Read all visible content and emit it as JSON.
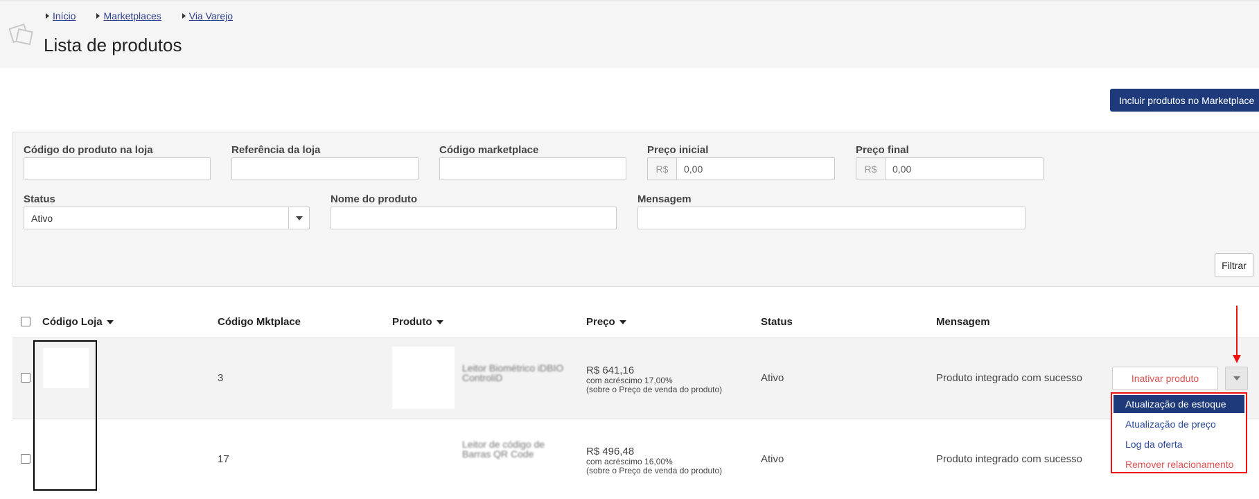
{
  "breadcrumb": [
    "Início",
    "Marketplaces",
    "Via Varejo"
  ],
  "page_title": "Lista de produtos",
  "include_button": "Incluir produtos no Marketplace",
  "filters": {
    "codigo_loja": {
      "label": "Código do produto na loja",
      "value": ""
    },
    "referencia": {
      "label": "Referência da loja",
      "value": ""
    },
    "codigo_marketplace": {
      "label": "Código marketplace",
      "value": ""
    },
    "preco_inicial": {
      "label": "Preço inicial",
      "prefix": "R$",
      "value": "0,00"
    },
    "preco_final": {
      "label": "Preço final",
      "prefix": "R$",
      "value": "0,00"
    },
    "status": {
      "label": "Status",
      "value": "Ativo"
    },
    "nome": {
      "label": "Nome do produto",
      "value": ""
    },
    "mensagem": {
      "label": "Mensagem",
      "value": ""
    },
    "filter_button": "Filtrar"
  },
  "table": {
    "headers": [
      "Código Loja",
      "Código Mktplace",
      "Produto",
      "Preço",
      "Status",
      "Mensagem"
    ],
    "rows": [
      {
        "codigo_mktplace": "3",
        "produto": "Leitor Biométrico iDBIO ControliD",
        "preco": "R$ 641,16",
        "acrescimo": "com acréscimo 17,00%",
        "sobre": "(sobre o Preço de venda do produto)",
        "status": "Ativo",
        "mensagem": "Produto integrado com sucesso"
      },
      {
        "codigo_mktplace": "17",
        "produto": "Leitor de código de Barras QR Code",
        "preco": "R$ 496,48",
        "acrescimo": "com acréscimo 16,00%",
        "sobre": "(sobre o Preço de venda do produto)",
        "status": "Ativo",
        "mensagem": "Produto integrado com sucesso"
      }
    ]
  },
  "row_actions": {
    "inactivate": "Inativar produto",
    "menu": [
      "Atualização de estoque",
      "Atualização de preço",
      "Log da oferta",
      "Remover relacionamento"
    ]
  },
  "colors": {
    "primary": "#1e3a7a",
    "danger": "#e05050",
    "annotation": "#ee1111"
  }
}
